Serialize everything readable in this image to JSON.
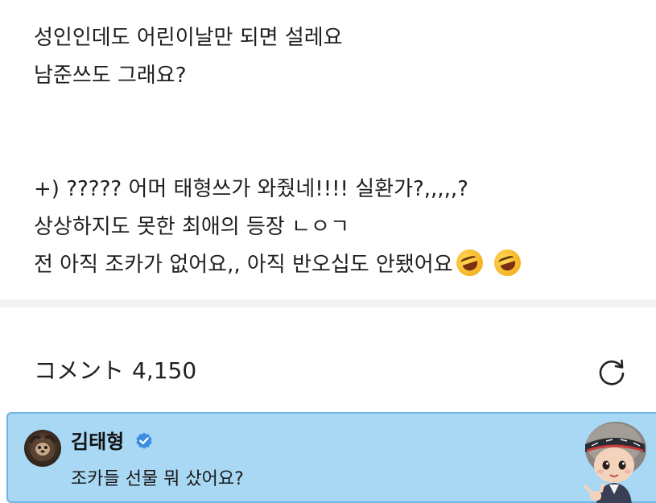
{
  "post": {
    "lines": [
      "성인인데도 어린이날만 되면 설레요",
      "남준쓰도 그래요?",
      "",
      "",
      "+) ????? 어머 태형쓰가 와줬네!!!! 실환가?,,,,,?",
      "상상하지도 못한 최애의 등장 ㄴㅇㄱ",
      "전 아직 조카가 없어요,, 아직 반오십도 안됐어요"
    ],
    "trailing_emoji": [
      "rolling-on-floor-laughing-emoji",
      "rolling-on-floor-laughing-emoji"
    ]
  },
  "comments": {
    "label": "コメント",
    "count": "4,150",
    "refresh_icon": "refresh-icon"
  },
  "comment": {
    "author": "김태형",
    "verified_icon": "verified-badge-icon",
    "text": "조카들 선물 뭐 샀어요?",
    "sticker_icon": "character-sticker",
    "highlight_color": "#a9d8f5",
    "border_color": "#6fb4e3",
    "badge_color": "#3b8de0"
  }
}
